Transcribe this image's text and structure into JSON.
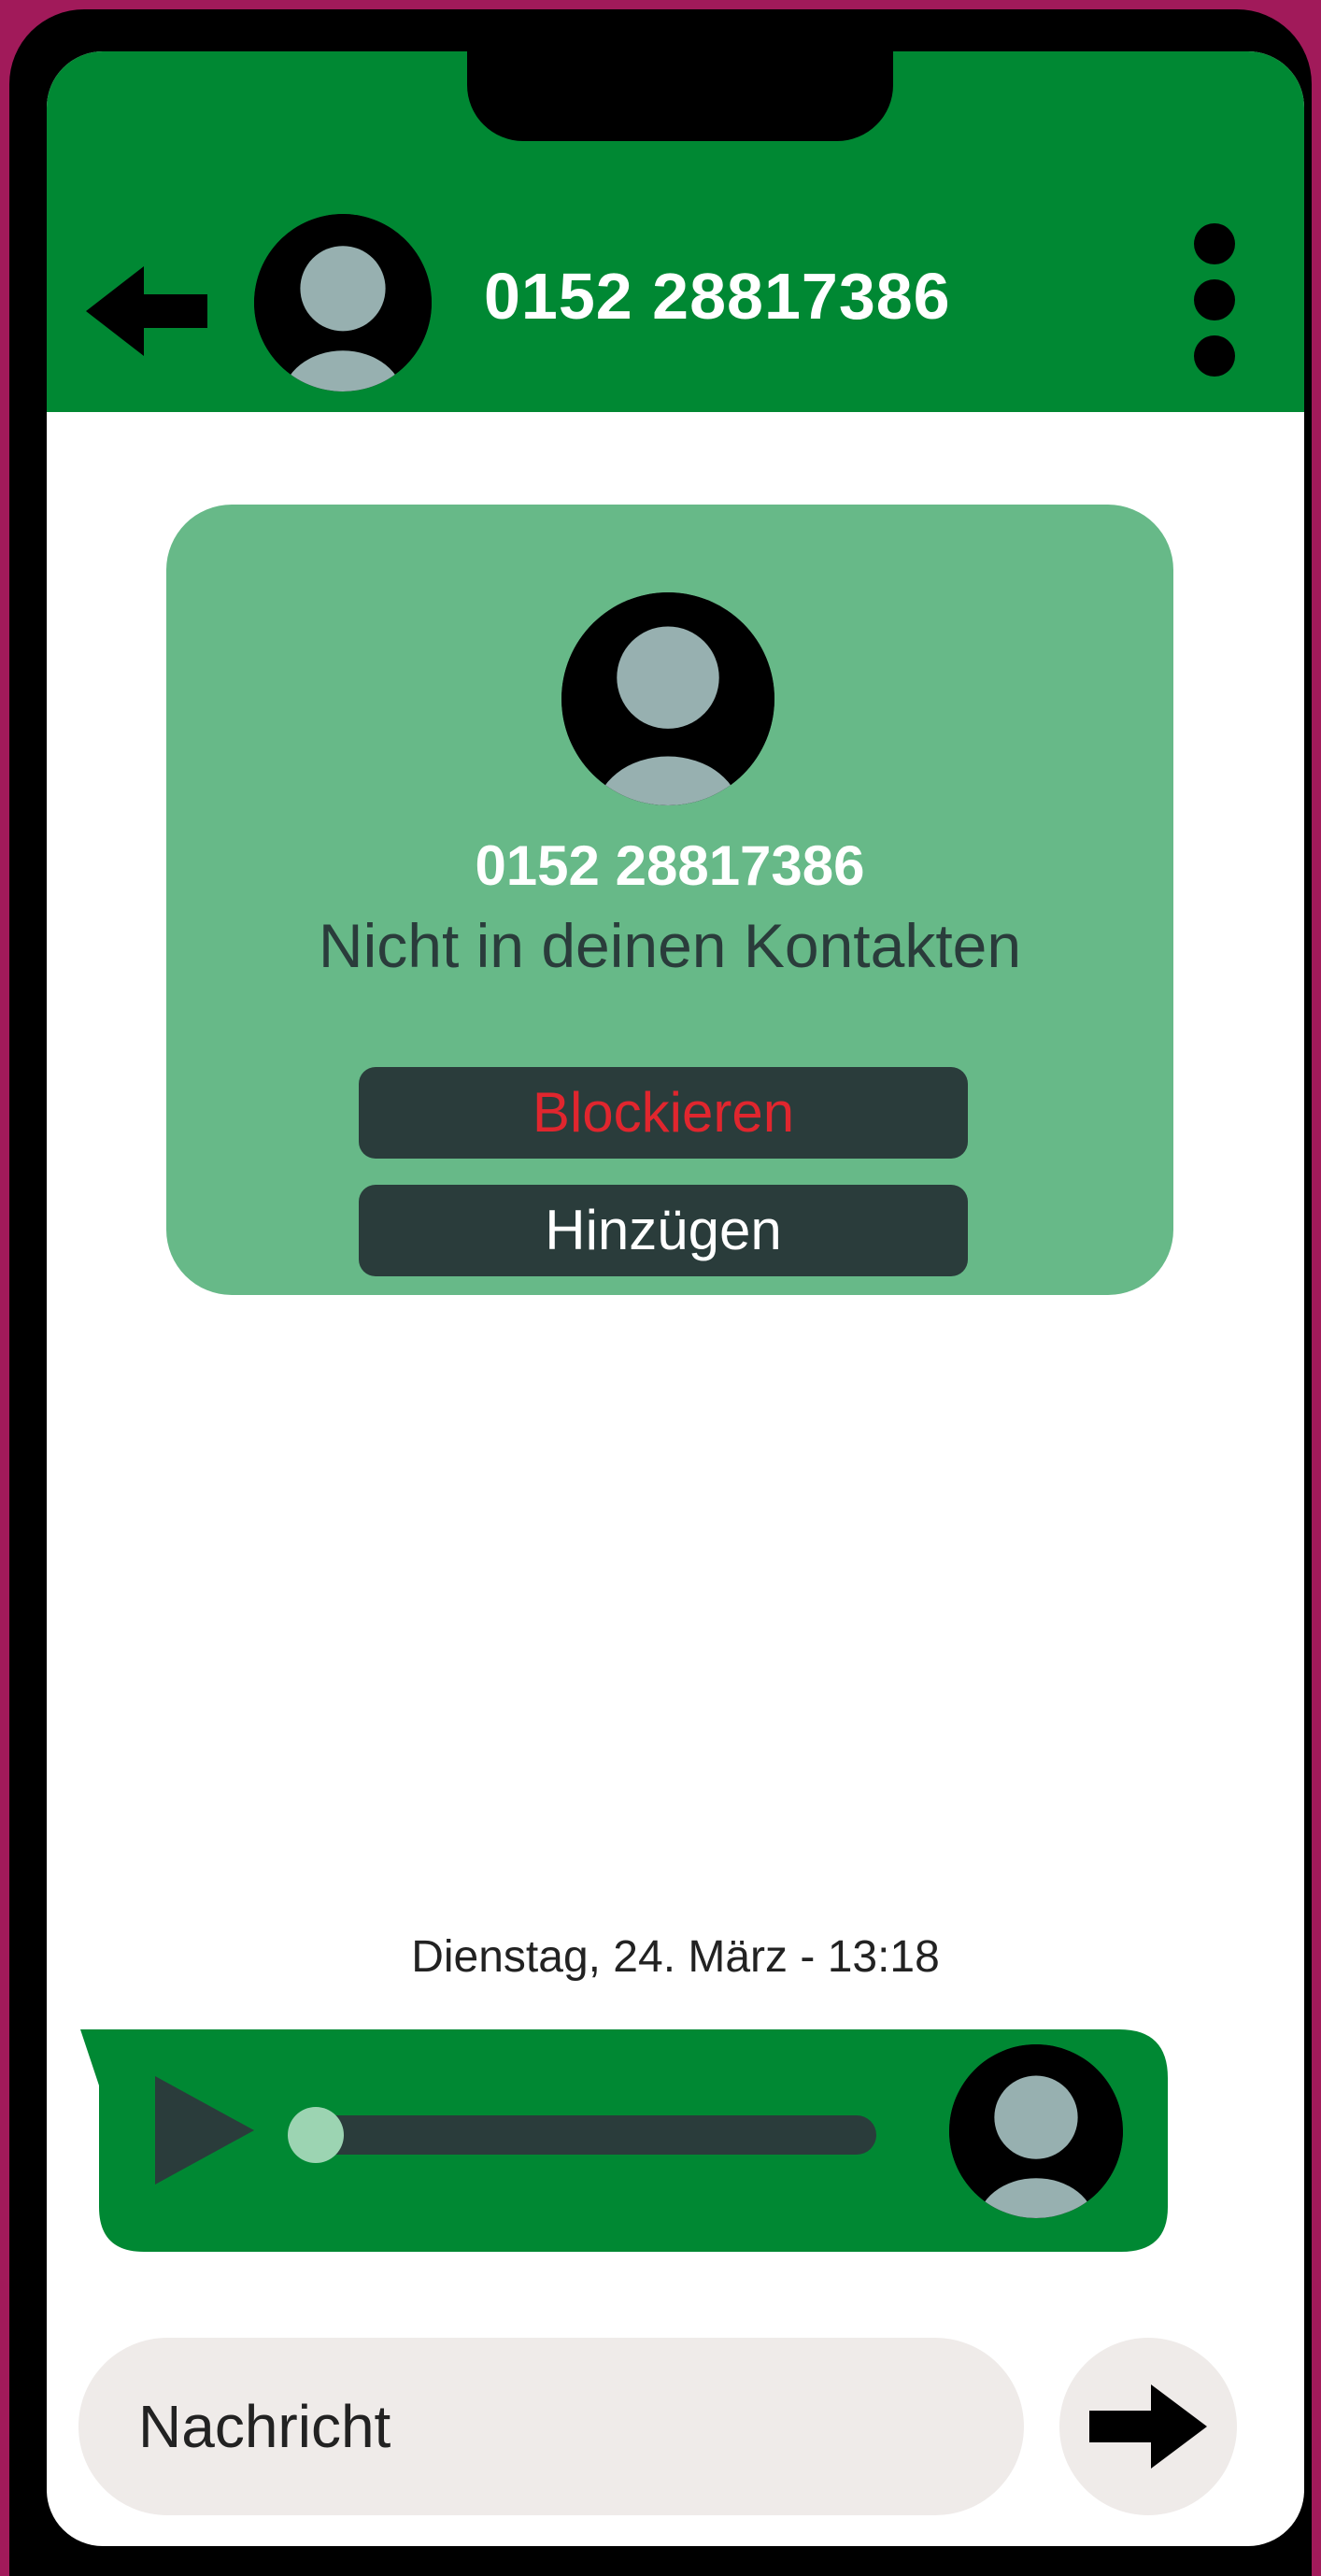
{
  "header": {
    "title": "0152 28817386",
    "back_icon": "arrow-left-icon",
    "menu_icon": "more-vertical-icon"
  },
  "contact_card": {
    "number": "0152 28817386",
    "status": "Nicht in deinen Kontakten",
    "block_label": "Blockieren",
    "add_label": "Hinzügen"
  },
  "chat": {
    "timestamp": "Dienstag, 24. März - 13:18",
    "voice_message": {
      "progress": 0.0
    }
  },
  "composer": {
    "placeholder": "Nachricht",
    "send_icon": "arrow-right-icon"
  },
  "colors": {
    "header": "#008833",
    "card": "#67b988",
    "button_dark": "#2a3c3b",
    "block_text": "#e0262e",
    "background_frame": "#a11a5a"
  }
}
